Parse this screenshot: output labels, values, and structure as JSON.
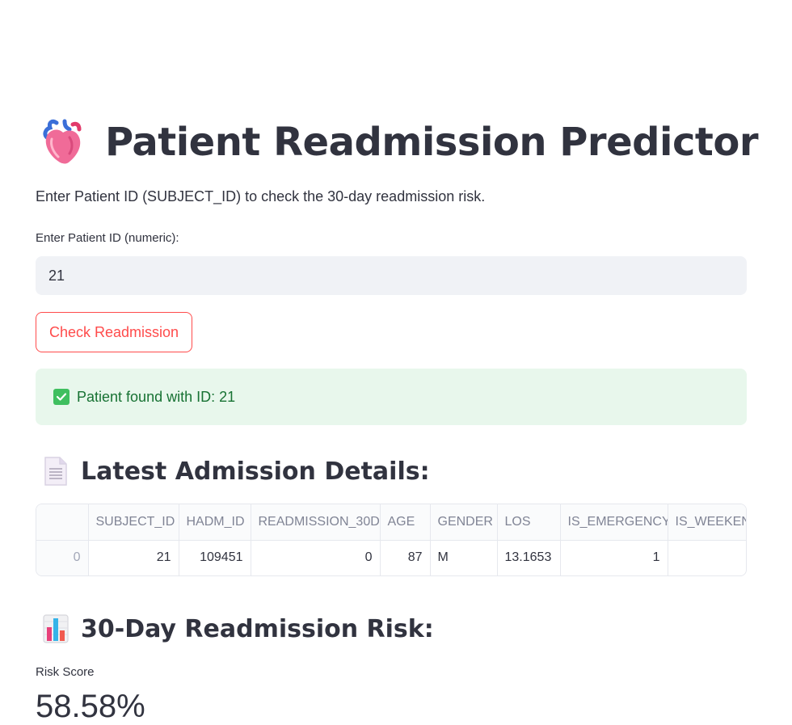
{
  "header": {
    "title": "Patient Readmission Predictor",
    "title_icon": "anatomical-heart-icon"
  },
  "intro_text": "Enter Patient ID (SUBJECT_ID) to check the 30-day readmission risk.",
  "form": {
    "patient_id_label": "Enter Patient ID (numeric):",
    "patient_id_value": "21",
    "check_button_label": "Check Readmission"
  },
  "alert": {
    "icon": "check-mark-button-icon",
    "text": "Patient found with ID: 21"
  },
  "admission_section": {
    "icon": "page-facing-up-icon",
    "title": "Latest Admission Details:",
    "columns": [
      "",
      "SUBJECT_ID",
      "HADM_ID",
      "READMISSION_30D",
      "AGE",
      "GENDER",
      "LOS",
      "IS_EMERGENCY",
      "IS_WEEKEND"
    ],
    "rows": [
      [
        "0",
        "21",
        "109451",
        "0",
        "87",
        "M",
        "13.1653",
        "1",
        ""
      ]
    ]
  },
  "risk_section": {
    "icon": "bar-chart-icon",
    "title": "30-Day Readmission Risk:",
    "metric_label": "Risk Score",
    "metric_value": "58.58%"
  },
  "colors": {
    "accent": "#ff4b4b",
    "text": "#31333f",
    "input_bg": "#f0f2f6",
    "success_bg": "#e8f7ec",
    "success_text": "#177233"
  }
}
